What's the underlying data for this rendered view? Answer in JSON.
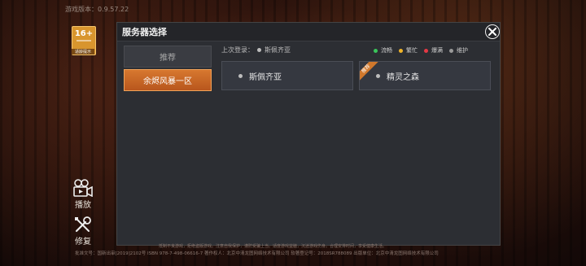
{
  "version_label": "游戏版本：0.9.57.22",
  "age_badge": {
    "rating": "16+",
    "tip": "适龄提示"
  },
  "side_buttons": [
    {
      "label": "播放",
      "icon": "video-camera-icon"
    },
    {
      "label": "修复",
      "icon": "wrench-icon"
    }
  ],
  "panel": {
    "title": "服务器选择",
    "tabs": [
      {
        "label": "推荐",
        "active": false
      },
      {
        "label": "余烬风暴一区",
        "active": true
      }
    ],
    "last_login_label": "上次登录：",
    "last_login_server": "斯佩齐亚",
    "legend": [
      {
        "label": "流畅",
        "color": "#3ac55a"
      },
      {
        "label": "繁忙",
        "color": "#f0b429"
      },
      {
        "label": "爆满",
        "color": "#e53945"
      },
      {
        "label": "维护",
        "color": "#9a9a9a"
      }
    ],
    "servers": [
      {
        "name": "斯佩齐亚",
        "status_color": "#bdbdbd",
        "recommended": false
      },
      {
        "name": "精灵之森",
        "status_color": "#bdbdbd",
        "recommended": true,
        "ribbon": "推荐"
      }
    ]
  },
  "footer": {
    "line1": "抵制不良游戏，拒绝盗版游戏。注意自我保护，谨防受骗上当。适度游戏益脑，沉迷游戏伤身。合理安排时间，享受健康生活。",
    "line2": "批准文号：国新出审[2019]2102号  ISBN 978-7-498-06616-7  著作权人：北京中清龙图网络技术有限公司  软著登记号：2018SR788089  出版单位：北京中清龙图网络技术有限公司"
  }
}
